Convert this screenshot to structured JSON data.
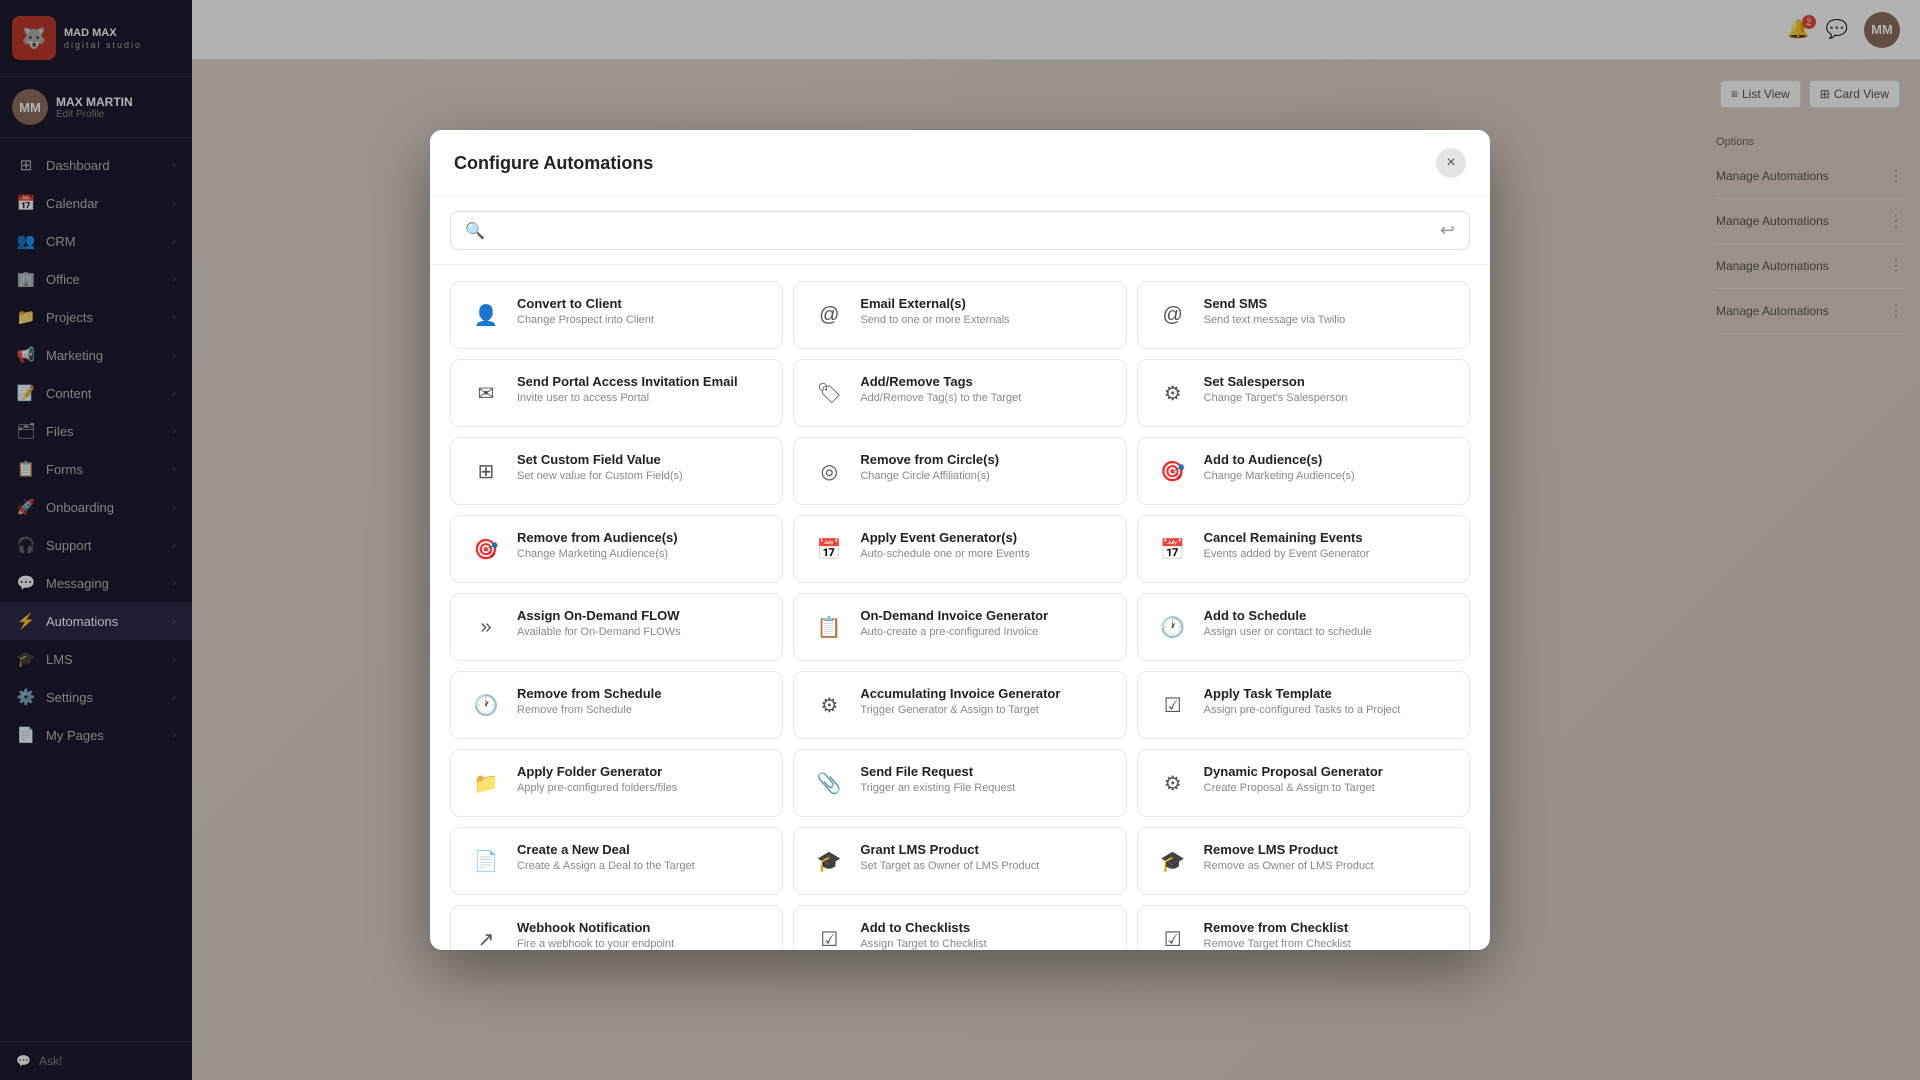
{
  "app": {
    "logo_name": "MAD MAX",
    "logo_sub": "digital studio"
  },
  "user": {
    "name": "MAX MARTIN",
    "edit_label": "Edit Profile",
    "initials": "MM"
  },
  "sidebar": {
    "items": [
      {
        "id": "dashboard",
        "label": "Dashboard",
        "icon": "⊞",
        "has_arrow": true
      },
      {
        "id": "calendar",
        "label": "Calendar",
        "icon": "📅",
        "has_arrow": true
      },
      {
        "id": "crm",
        "label": "CRM",
        "icon": "👥",
        "has_arrow": true
      },
      {
        "id": "office",
        "label": "Office",
        "icon": "🏢",
        "has_arrow": true
      },
      {
        "id": "projects",
        "label": "Projects",
        "icon": "📁",
        "has_arrow": true
      },
      {
        "id": "marketing",
        "label": "Marketing",
        "icon": "📢",
        "has_arrow": true
      },
      {
        "id": "content",
        "label": "Content",
        "icon": "📝",
        "has_arrow": true
      },
      {
        "id": "files",
        "label": "Files",
        "icon": "🗂",
        "has_arrow": true
      },
      {
        "id": "forms",
        "label": "Forms",
        "icon": "📋",
        "has_arrow": true
      },
      {
        "id": "onboarding",
        "label": "Onboarding",
        "icon": "🚀",
        "has_arrow": true
      },
      {
        "id": "support",
        "label": "Support",
        "icon": "🎧",
        "has_arrow": true
      },
      {
        "id": "messaging",
        "label": "Messaging",
        "icon": "💬",
        "has_arrow": true
      },
      {
        "id": "automations",
        "label": "Automations",
        "icon": "⚡",
        "has_arrow": true,
        "active": true
      },
      {
        "id": "lms",
        "label": "LMS",
        "icon": "🎓",
        "has_arrow": true
      },
      {
        "id": "settings",
        "label": "Settings",
        "icon": "⚙️",
        "has_arrow": true
      },
      {
        "id": "mypages",
        "label": "My Pages",
        "icon": "📄",
        "has_arrow": true
      }
    ],
    "ask_label": "Ask!"
  },
  "modal": {
    "title": "Configure Automations",
    "close_label": "×",
    "search_placeholder": "",
    "back_icon": "←",
    "automation_cards": [
      {
        "id": "convert-to-client",
        "title": "Convert to Client",
        "desc": "Change Prospect into Client",
        "icon": "👤"
      },
      {
        "id": "email-externals",
        "title": "Email External(s)",
        "desc": "Send to one or more Externals",
        "icon": "@"
      },
      {
        "id": "send-sms",
        "title": "Send SMS",
        "desc": "Send text message via Twilio",
        "icon": "@"
      },
      {
        "id": "send-portal-access",
        "title": "Send Portal Access Invitation Email",
        "desc": "Invite user to access Portal",
        "icon": "✉"
      },
      {
        "id": "add-remove-tags",
        "title": "Add/Remove Tags",
        "desc": "Add/Remove Tag(s) to the Target",
        "icon": "🏷"
      },
      {
        "id": "set-salesperson",
        "title": "Set Salesperson",
        "desc": "Change Target's Salesperson",
        "icon": "⚙"
      },
      {
        "id": "set-custom-field",
        "title": "Set Custom Field Value",
        "desc": "Set new value for Custom Field(s)",
        "icon": "⊞"
      },
      {
        "id": "remove-from-circle",
        "title": "Remove from Circle(s)",
        "desc": "Change Circle Affiliation(s)",
        "icon": "◎"
      },
      {
        "id": "add-to-audiences",
        "title": "Add to Audience(s)",
        "desc": "Change Marketing Audience(s)",
        "icon": "🎯"
      },
      {
        "id": "remove-from-audiences",
        "title": "Remove from Audience(s)",
        "desc": "Change Marketing Audience(s)",
        "icon": "🎯"
      },
      {
        "id": "apply-event-generator",
        "title": "Apply Event Generator(s)",
        "desc": "Auto-schedule one or more Events",
        "icon": "📅"
      },
      {
        "id": "cancel-remaining-events",
        "title": "Cancel Remaining Events",
        "desc": "Events added by Event Generator",
        "icon": "📅"
      },
      {
        "id": "assign-on-demand-flow",
        "title": "Assign On-Demand FLOW",
        "desc": "Available for On-Demand FLOWs",
        "icon": "»"
      },
      {
        "id": "on-demand-invoice-generator",
        "title": "On-Demand Invoice Generator",
        "desc": "Auto-create a pre-configured Invoice",
        "icon": "📋"
      },
      {
        "id": "add-to-schedule",
        "title": "Add to Schedule",
        "desc": "Assign user or contact to schedule",
        "icon": "🕐"
      },
      {
        "id": "remove-from-schedule",
        "title": "Remove from Schedule",
        "desc": "Remove from Schedule",
        "icon": "🕐"
      },
      {
        "id": "accumulating-invoice-generator",
        "title": "Accumulating Invoice Generator",
        "desc": "Trigger Generator & Assign to Target",
        "icon": "⚙"
      },
      {
        "id": "apply-task-template",
        "title": "Apply Task Template",
        "desc": "Assign pre-configured Tasks to a Project",
        "icon": "☑"
      },
      {
        "id": "apply-folder-generator",
        "title": "Apply Folder Generator",
        "desc": "Apply pre-configured folders/files",
        "icon": "📁"
      },
      {
        "id": "send-file-request",
        "title": "Send File Request",
        "desc": "Trigger an existing File Request",
        "icon": "📎"
      },
      {
        "id": "dynamic-proposal-generator",
        "title": "Dynamic Proposal Generator",
        "desc": "Create Proposal & Assign to Target",
        "icon": "⚙"
      },
      {
        "id": "create-new-deal",
        "title": "Create a New Deal",
        "desc": "Create & Assign a Deal to the Target",
        "icon": "📄"
      },
      {
        "id": "grant-lms-product",
        "title": "Grant LMS Product",
        "desc": "Set Target as Owner of LMS Product",
        "icon": "🎓"
      },
      {
        "id": "remove-lms-product",
        "title": "Remove LMS Product",
        "desc": "Remove as Owner of LMS Product",
        "icon": "🎓"
      },
      {
        "id": "webhook-notification",
        "title": "Webhook Notification",
        "desc": "Fire a webhook to your endpoint",
        "icon": "↗"
      },
      {
        "id": "add-to-checklists",
        "title": "Add to Checklists",
        "desc": "Assign Target to Checklist",
        "icon": "☑"
      },
      {
        "id": "remove-from-checklist",
        "title": "Remove from Checklist",
        "desc": "Remove Target from Checklist",
        "icon": "☑"
      }
    ]
  },
  "header": {
    "notification_count": "2",
    "list_view_label": "List View",
    "card_view_label": "Card View",
    "options_label": "Options"
  },
  "manage_items": [
    "Manage Automations",
    "Manage Automations",
    "Manage Automations",
    "Manage Automations"
  ]
}
